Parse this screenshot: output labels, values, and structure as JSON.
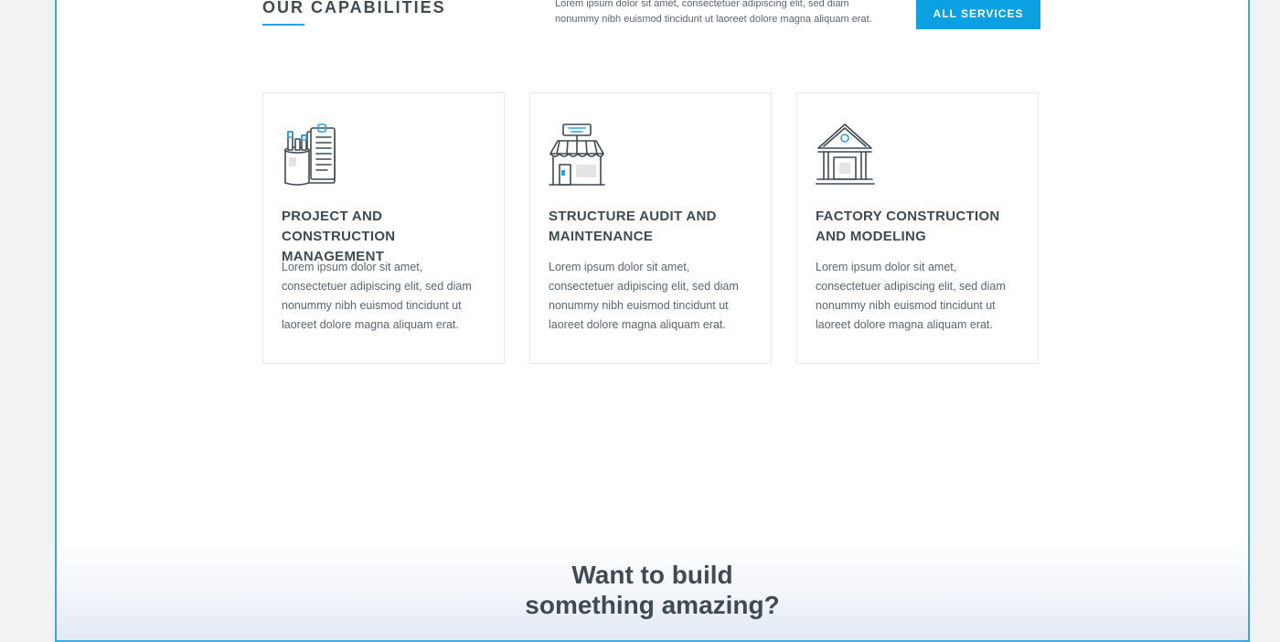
{
  "section": {
    "title": "OUR CAPABILITIES",
    "intro": "Lorem ipsum dolor sit amet, consectetuer adipiscing elit, sed diam nonummy nibh euismod tincidunt ut laoreet dolore magna aliquam erat.",
    "button_label": "ALL SERVICES"
  },
  "cards": [
    {
      "icon": "office-supplies-icon",
      "title": "PROJECT AND CONSTRUCTION MANAGEMENT",
      "text": "Lorem ipsum dolor sit amet, consectetuer adipiscing elit, sed diam nonummy nibh euismod tincidunt ut laoreet dolore magna aliquam erat."
    },
    {
      "icon": "storefront-icon",
      "title": "STRUCTURE AUDIT AND MAINTENANCE",
      "text": "Lorem ipsum dolor sit amet, consectetuer adipiscing elit, sed diam nonummy nibh euismod tincidunt ut laoreet dolore magna aliquam erat."
    },
    {
      "icon": "institution-building-icon",
      "title": "FACTORY CONSTRUCTION AND MODELING",
      "text": "Lorem ipsum dolor sit amet, consectetuer adipiscing elit, sed diam nonummy nibh euismod tincidunt ut laoreet dolore magna aliquam erat."
    }
  ],
  "cta": {
    "line1": "Want to build",
    "line2": "something amazing?"
  },
  "colors": {
    "accent": "#0aa0e2",
    "text_dark": "#3f4a54",
    "text_body": "#5b6670",
    "frame_border": "#3aa7e3",
    "background": "#f2f2f2"
  }
}
